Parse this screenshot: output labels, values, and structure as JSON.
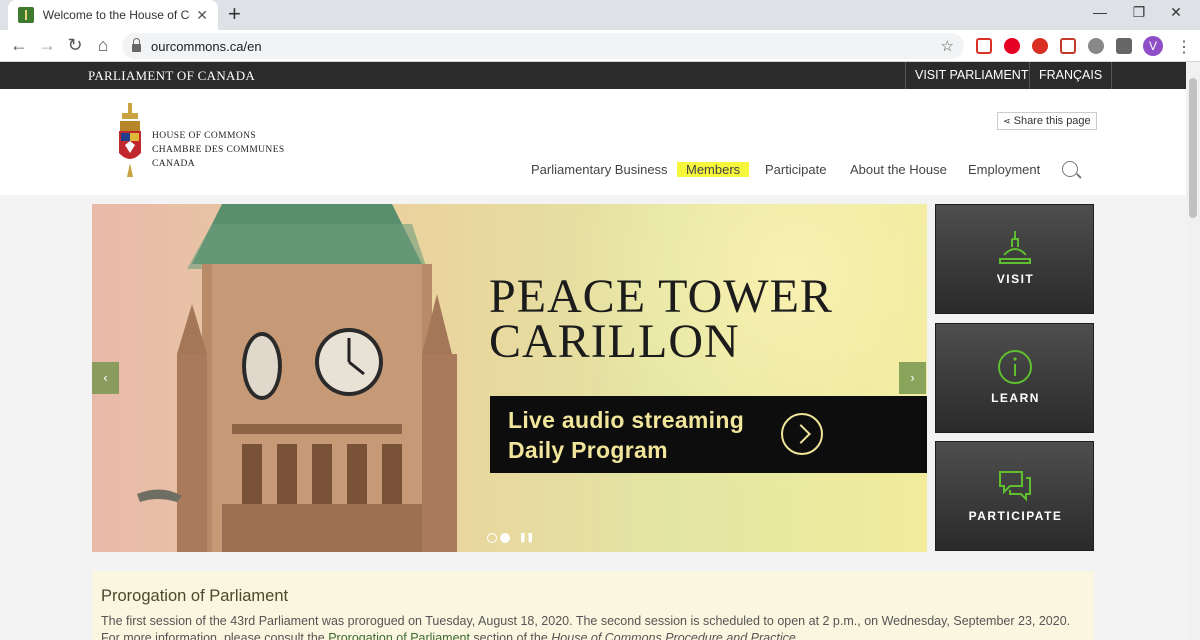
{
  "browser": {
    "tab_title": "Welcome to the House of Comm",
    "url": "ourcommons.ca/en",
    "profile_initial": "V"
  },
  "site": {
    "parliament_label": "PARLIAMENT OF CANADA",
    "visit_parliament": "VISIT PARLIAMENT",
    "francais": "FRANÇAIS",
    "logo_line1": "HOUSE OF COMMONS",
    "logo_line2": "CHAMBRE DES COMMUNES",
    "logo_line3": "CANADA",
    "share": "Share this page",
    "nav": [
      "Parliamentary Business",
      "Members",
      "Participate",
      "About the House",
      "Employment"
    ]
  },
  "hero": {
    "title_line1": "PEACE TOWER",
    "title_line2": "CARILLON",
    "box_line1": "Live audio streaming",
    "box_line2": "Daily Program"
  },
  "tiles": [
    "VISIT",
    "LEARN",
    "PARTICIPATE"
  ],
  "notice": {
    "title": "Prorogation of Parliament",
    "body_part1": "The first session of the 43rd Parliament was prorogued on Tuesday, August 18, 2020. The second session is scheduled to open at 2 p.m., on Wednesday, September 23, 2020. For more information, please consult the ",
    "link": "Prorogation of Parliament",
    "body_part2": " section of the ",
    "book": "House of Commons Procedure and Practice",
    "body_part3": "."
  },
  "colors": {
    "accent_green": "#3b6a30",
    "highlight": "#f6f63d",
    "tile_icon_green": "#5fbf2f"
  }
}
